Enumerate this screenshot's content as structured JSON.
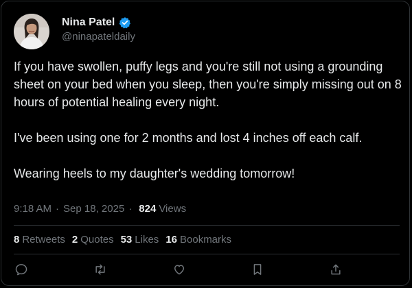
{
  "tweet": {
    "author": {
      "display_name": "Nina Patel",
      "handle": "@ninapateldaily",
      "verified": true
    },
    "paragraphs": [
      "If you have swollen, puffy legs and you're still not using a grounding sheet on your bed when you sleep, then you're simply missing out on 8 hours of potential healing every night.",
      "I've been using one for 2 months and lost 4 inches off each calf.",
      "Wearing heels to my daughter's wedding tomorrow!"
    ],
    "meta": {
      "time": "9:18 AM",
      "separator": "·",
      "date": "Sep 18, 2025",
      "views_count": "824",
      "views_label": "Views"
    },
    "stats": [
      {
        "count": "8",
        "label": "Retweets"
      },
      {
        "count": "2",
        "label": "Quotes"
      },
      {
        "count": "53",
        "label": "Likes"
      },
      {
        "count": "16",
        "label": "Bookmarks"
      }
    ],
    "actions": [
      {
        "icon": "reply-icon"
      },
      {
        "icon": "retweet-icon"
      },
      {
        "icon": "like-icon"
      },
      {
        "icon": "bookmark-icon"
      },
      {
        "icon": "share-icon"
      }
    ]
  },
  "colors": {
    "background": "#000000",
    "text_primary": "#e7e9ea",
    "text_secondary": "#71767b",
    "border": "#2f3336",
    "verified": "#1d9bf0"
  }
}
